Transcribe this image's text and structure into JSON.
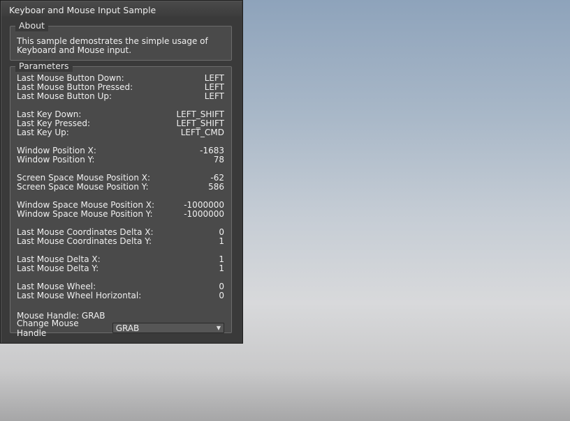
{
  "window": {
    "title": "Keyboar and Mouse Input Sample"
  },
  "about": {
    "legend": "About",
    "line1": "This sample demostrates the simple usage of",
    "line2": "Keyboard and Mouse input."
  },
  "parameters": {
    "legend": "Parameters",
    "groups": [
      [
        {
          "label": "Last Mouse Button Down:",
          "value": "LEFT"
        },
        {
          "label": "Last Mouse Button Pressed:",
          "value": "LEFT"
        },
        {
          "label": "Last Mouse Button Up:",
          "value": "LEFT"
        }
      ],
      [
        {
          "label": "Last Key Down:",
          "value": "LEFT_SHIFT"
        },
        {
          "label": "Last Key Pressed:",
          "value": "LEFT_SHIFT"
        },
        {
          "label": "Last Key Up:",
          "value": "LEFT_CMD"
        }
      ],
      [
        {
          "label": "Window Position X:",
          "value": "-1683"
        },
        {
          "label": "Window Position Y:",
          "value": "78"
        }
      ],
      [
        {
          "label": "Screen Space Mouse Position X:",
          "value": "-62"
        },
        {
          "label": "Screen Space Mouse Position Y:",
          "value": "586"
        }
      ],
      [
        {
          "label": "Window Space Mouse Position X:",
          "value": "-1000000"
        },
        {
          "label": "Window Space Mouse Position Y:",
          "value": "-1000000"
        }
      ],
      [
        {
          "label": "Last Mouse Coordinates Delta X:",
          "value": "0"
        },
        {
          "label": "Last Mouse Coordinates Delta Y:",
          "value": "1"
        }
      ],
      [
        {
          "label": "Last Mouse Delta X:",
          "value": "1"
        },
        {
          "label": "Last Mouse Delta Y:",
          "value": "1"
        }
      ],
      [
        {
          "label": "Last Mouse Wheel:",
          "value": "0"
        },
        {
          "label": "Last Mouse Wheel Horizontal:",
          "value": "0"
        }
      ]
    ],
    "mouse_handle_text": "Mouse Handle: GRAB",
    "change_handle_label": "Change Mouse Handle",
    "change_handle_value": "GRAB"
  },
  "icons": {
    "dropdown": "chevron-down-icon"
  }
}
